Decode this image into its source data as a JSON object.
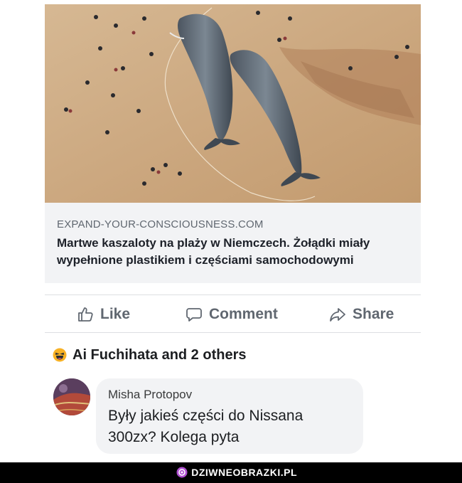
{
  "post": {
    "image": {
      "icon": "whale-beach-photo"
    },
    "link": {
      "domain": "EXPAND-YOUR-CONSCIOUSNESS.COM",
      "headline": "Martwe kaszaloty na plaży w Niemczech. Żołądki miały wypełnione plastikiem i częściami samochodowymi"
    },
    "actions": {
      "like": "Like",
      "comment": "Comment",
      "share": "Share"
    },
    "reactions": {
      "icon": "haha-emoji-icon",
      "text": "Ai Fuchihata and 2 others"
    },
    "comment": {
      "author": "Misha Protopov",
      "text": "Były jakieś części do Nissana 300zx? Kolega pyta"
    }
  },
  "watermark": {
    "text": "DZIWNEOBRAZKI.PL",
    "icon": "dziwneobrazki-logo-icon"
  },
  "colors": {
    "action_gray": "#606770",
    "preview_bg": "#f2f3f5",
    "divider": "#dddfe2",
    "sand": "#cfae8a"
  }
}
